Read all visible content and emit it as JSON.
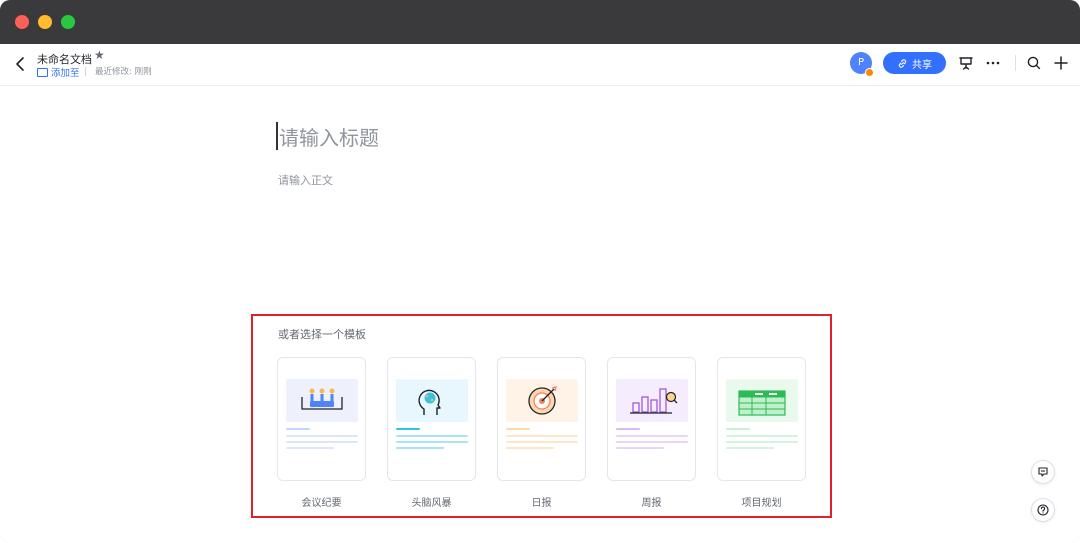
{
  "header": {
    "doc_title": "未命名文档",
    "add_to_label": "添加至",
    "last_modified": "最近修改: 刚刚",
    "avatar_initial": "P",
    "share_label": "共享"
  },
  "editor": {
    "title_placeholder": "请输入标题",
    "body_placeholder": "请输入正文"
  },
  "templates": {
    "heading": "或者选择一个模板",
    "items": [
      {
        "label": "会议纪要",
        "icon": "meeting-icon",
        "tint": "#eef1fb",
        "accent": "#4e83fd"
      },
      {
        "label": "头脑风暴",
        "icon": "brainstorm-icon",
        "tint": "#e7f7fd",
        "accent": "#34c3e8"
      },
      {
        "label": "日报",
        "icon": "target-icon",
        "tint": "#fff3e8",
        "accent": "#ffc98a"
      },
      {
        "label": "周报",
        "icon": "bar-chart-icon",
        "tint": "#f5ecfd",
        "accent": "#c38cf0"
      },
      {
        "label": "项目规划",
        "icon": "table-icon",
        "tint": "#eaf9ee",
        "accent": "#5fd27a"
      }
    ]
  },
  "colors": {
    "brand": "#3370ff",
    "highlight_border": "#e0202a"
  }
}
